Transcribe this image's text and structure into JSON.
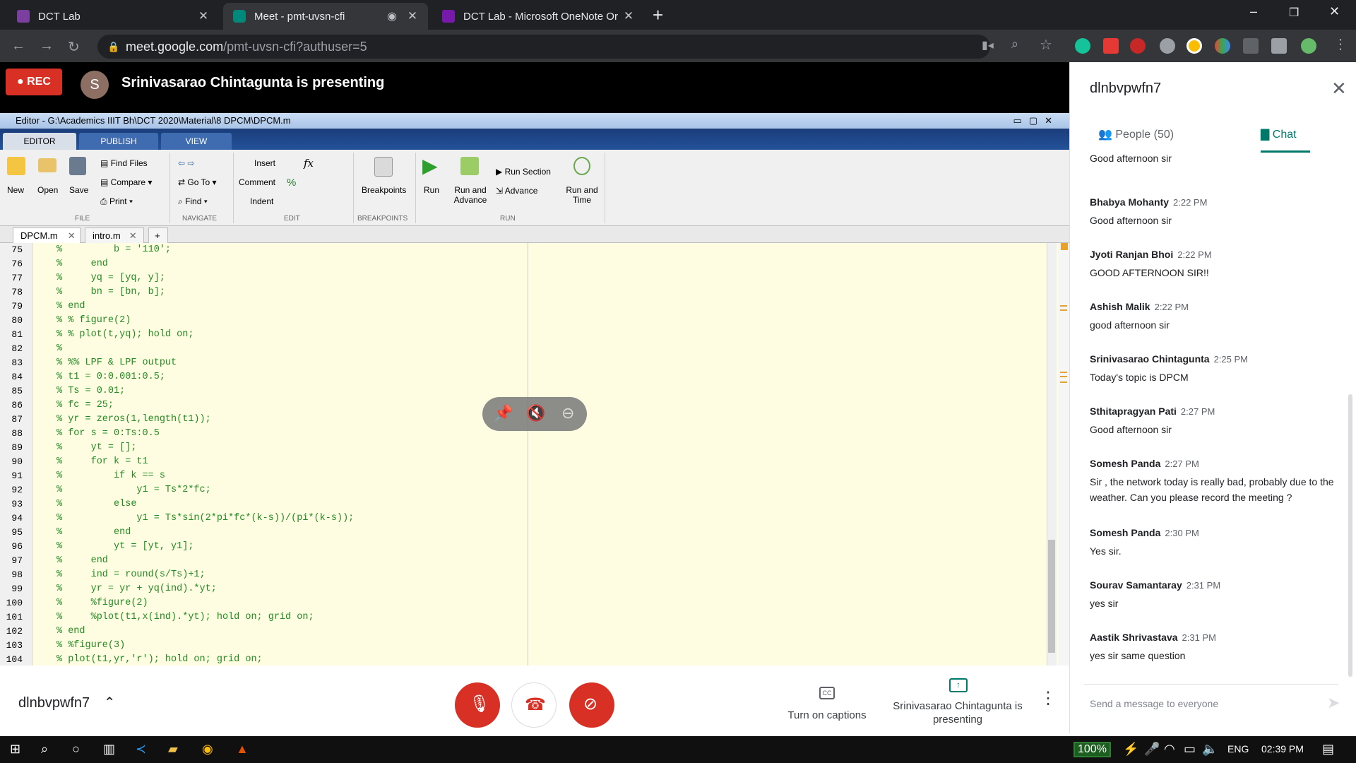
{
  "browser": {
    "tabs": [
      {
        "title": "DCT Lab",
        "favicon_color": "#7b3fa0"
      },
      {
        "title": "Meet - pmt-uvsn-cfi",
        "favicon_color": "#00897b"
      },
      {
        "title": "DCT Lab - Microsoft OneNote Or",
        "favicon_color": "#7719aa"
      }
    ],
    "new_tab": "+",
    "url_host": "meet.google.com",
    "url_path": "/pmt-uvsn-cfi?authuser=5",
    "window_controls": [
      "–",
      "❐",
      "✕"
    ]
  },
  "meet": {
    "rec_label": "REC",
    "presenter_initial": "S",
    "presenting_text": "Srinivasarao Chintagunta is presenting",
    "meeting_code": "dlnbvpwfn7",
    "captions_label": "Turn on captions",
    "presenter_label": "Srinivasarao Chintagunta is presenting",
    "colors": {
      "end_call": "#ffffff",
      "mic_off": "#d93025",
      "cam_off": "#d93025",
      "accent": "#00796b"
    }
  },
  "matlab": {
    "title": "Editor - G:\\Academics IIIT Bh\\DCT 2020\\Material\\8 DPCM\\DPCM.m",
    "tabs": [
      "EDITOR",
      "PUBLISH",
      "VIEW"
    ],
    "file": {
      "new": "New",
      "open": "Open",
      "save": "Save",
      "find_files": "Find Files",
      "compare": "Compare",
      "print": "Print",
      "section": "FILE"
    },
    "navigate": {
      "go_to": "Go To",
      "find": "Find",
      "section": "NAVIGATE"
    },
    "edit": {
      "insert": "Insert",
      "comment": "Comment",
      "indent": "Indent",
      "fx": "fx",
      "pct": "%",
      "section": "EDIT"
    },
    "breakpoints": {
      "label": "Breakpoints",
      "section": "BREAKPOINTS"
    },
    "run": {
      "run": "Run",
      "run_advance": "Run and Advance",
      "run_section": "Run Section",
      "advance": "Advance",
      "run_time": "Run and Time",
      "section": "RUN"
    },
    "doc_tabs": [
      "DPCM.m",
      "intro.m"
    ],
    "add_tab": "+",
    "lines": [
      {
        "n": "75",
        "code": "%         b = '110';"
      },
      {
        "n": "76",
        "code": "%     end"
      },
      {
        "n": "77",
        "code": "%     yq = [yq, y];"
      },
      {
        "n": "78",
        "code": "%     bn = [bn, b];"
      },
      {
        "n": "79",
        "code": "% end"
      },
      {
        "n": "80",
        "code": "% % figure(2)"
      },
      {
        "n": "81",
        "code": "% % plot(t,yq); hold on;"
      },
      {
        "n": "82",
        "code": "%"
      },
      {
        "n": "83",
        "code": "% %% LPF & LPF output"
      },
      {
        "n": "84",
        "code": "% t1 = 0:0.001:0.5;"
      },
      {
        "n": "85",
        "code": "% Ts = 0.01;"
      },
      {
        "n": "86",
        "code": "% fc = 25;"
      },
      {
        "n": "87",
        "code": "% yr = zeros(1,length(t1));"
      },
      {
        "n": "88",
        "code": "% for s = 0:Ts:0.5"
      },
      {
        "n": "89",
        "code": "%     yt = [];"
      },
      {
        "n": "90",
        "code": "%     for k = t1"
      },
      {
        "n": "91",
        "code": "%         if k == s"
      },
      {
        "n": "92",
        "code": "%             y1 = Ts*2*fc;"
      },
      {
        "n": "93",
        "code": "%         else"
      },
      {
        "n": "94",
        "code": "%             y1 = Ts*sin(2*pi*fc*(k-s))/(pi*(k-s));"
      },
      {
        "n": "95",
        "code": "%         end"
      },
      {
        "n": "96",
        "code": "%         yt = [yt, y1];"
      },
      {
        "n": "97",
        "code": "%     end"
      },
      {
        "n": "98",
        "code": "%     ind = round(s/Ts)+1;"
      },
      {
        "n": "99",
        "code": "%     yr = yr + yq(ind).*yt;"
      },
      {
        "n": "100",
        "code": "%     %figure(2)"
      },
      {
        "n": "101",
        "code": "%     %plot(t1,x(ind).*yt); hold on; grid on;"
      },
      {
        "n": "102",
        "code": "% end"
      },
      {
        "n": "103",
        "code": "% %figure(3)"
      },
      {
        "n": "104",
        "code": "% plot(t1,yr,'r'); hold on; grid on;"
      }
    ]
  },
  "chat": {
    "header": "dlnbvpwfn7",
    "people_tab": "People (50)",
    "chat_tab": "Chat",
    "messages": [
      {
        "sender": "",
        "time": "",
        "text": "Good afternoon sir"
      },
      {
        "sender": "Bhabya Mohanty",
        "time": "2:22 PM",
        "text": "Good afternoon sir"
      },
      {
        "sender": "Jyoti Ranjan Bhoi",
        "time": "2:22 PM",
        "text": "GOOD AFTERNOON SIR!!"
      },
      {
        "sender": "Ashish Malik",
        "time": "2:22 PM",
        "text": "good afternoon sir"
      },
      {
        "sender": "Srinivasarao Chintagunta",
        "time": "2:25 PM",
        "text": "Today's topic is DPCM"
      },
      {
        "sender": "Sthitapragyan Pati",
        "time": "2:27 PM",
        "text": "Good afternoon sir"
      },
      {
        "sender": "Somesh Panda",
        "time": "2:27 PM",
        "text": "Sir , the network today is really bad, probably due to the weather. Can you please record the meeting ?"
      },
      {
        "sender": "Somesh Panda",
        "time": "2:30 PM",
        "text": "Yes sir."
      },
      {
        "sender": "Sourav Samantaray",
        "time": "2:31 PM",
        "text": "yes sir"
      },
      {
        "sender": "Aastik Shrivastava",
        "time": "2:31 PM",
        "text": "yes sir same question"
      }
    ],
    "input_placeholder": "Send a message to everyone"
  },
  "taskbar": {
    "battery": "100%",
    "lang": "ENG",
    "time": "02:39 PM"
  }
}
